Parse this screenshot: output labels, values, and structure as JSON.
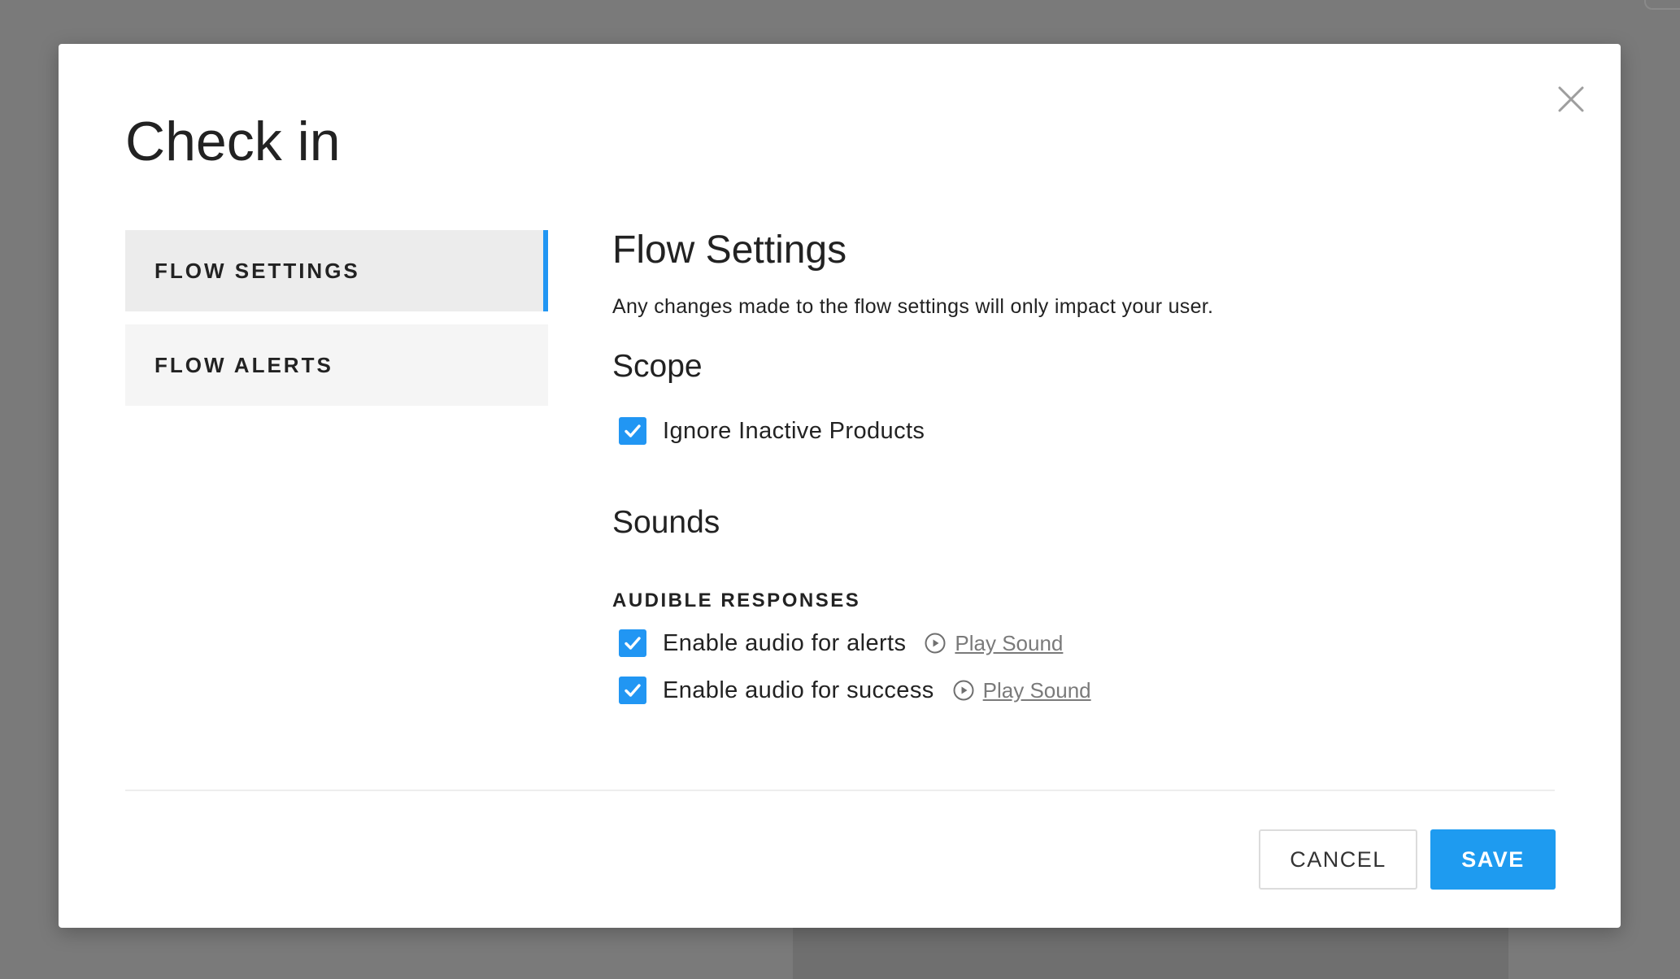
{
  "modal": {
    "title": "Check in",
    "close_icon": "close-icon"
  },
  "nav": {
    "items": [
      {
        "label": "FLOW SETTINGS",
        "active": true
      },
      {
        "label": "FLOW ALERTS",
        "active": false
      }
    ]
  },
  "content": {
    "title": "Flow Settings",
    "description": "Any changes made to the flow settings will only impact your user.",
    "scope": {
      "title": "Scope",
      "ignore_inactive_label": "Ignore Inactive Products",
      "ignore_inactive_checked": true
    },
    "sounds": {
      "title": "Sounds",
      "group_label": "AUDIBLE RESPONSES",
      "alerts_label": "Enable audio for alerts",
      "alerts_checked": true,
      "alerts_play": "Play Sound",
      "success_label": "Enable audio for success",
      "success_checked": true,
      "success_play": "Play Sound"
    }
  },
  "footer": {
    "cancel_label": "CANCEL",
    "save_label": "SAVE"
  },
  "colors": {
    "accent": "#2196f3",
    "overlay": "#7a7a7a",
    "text": "#222222",
    "link": "#7a7a7a"
  }
}
